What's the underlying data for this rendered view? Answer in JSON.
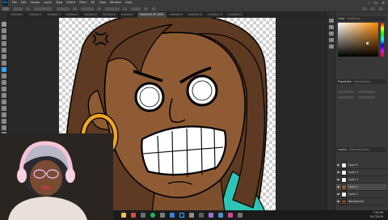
{
  "menu": {
    "items": [
      "File",
      "Edit",
      "Image",
      "Layer",
      "Type",
      "Select",
      "Filter",
      "3D",
      "View",
      "Window",
      "Help"
    ]
  },
  "window": {
    "minimize": "–",
    "maximize": "☐",
    "close": "✕"
  },
  "tabs": [
    {
      "label": "Untitled-1"
    },
    {
      "label": "Untitled-2"
    },
    {
      "label": "Untitled-3"
    },
    {
      "label": "Untitled-4"
    },
    {
      "label": "Untitled-5"
    },
    {
      "label": "Untitled-6"
    },
    {
      "label": "Untitled-7"
    },
    {
      "label": "Untitled-8 @ 100%"
    },
    {
      "label": "Untitled-9"
    },
    {
      "label": "Untitled-10"
    },
    {
      "label": "Untitled-11"
    },
    {
      "label": "Untitled-12"
    }
  ],
  "panels": {
    "color": {
      "title": "Color",
      "subtitle": "Swatches"
    },
    "properties": {
      "title": "Properties",
      "subtitle": "Adjustments"
    },
    "layers": {
      "title": "Layers",
      "subtitle": "Channels  Paths"
    }
  },
  "layers": [
    {
      "name": "Layer 5"
    },
    {
      "name": "Layer 4"
    },
    {
      "name": "Layer 3"
    },
    {
      "name": "Layer 2"
    },
    {
      "name": "Layer 1"
    },
    {
      "name": "Background"
    }
  ],
  "taskbar": {
    "time": "7:56 PM",
    "date": "5/17/2019"
  },
  "colors": {
    "hair": "#5e3a22",
    "skin": "#8e5b34",
    "earring": "#f0a426",
    "shirt": "#2ec4b6",
    "accent_photoshop": "#31a8ff"
  }
}
